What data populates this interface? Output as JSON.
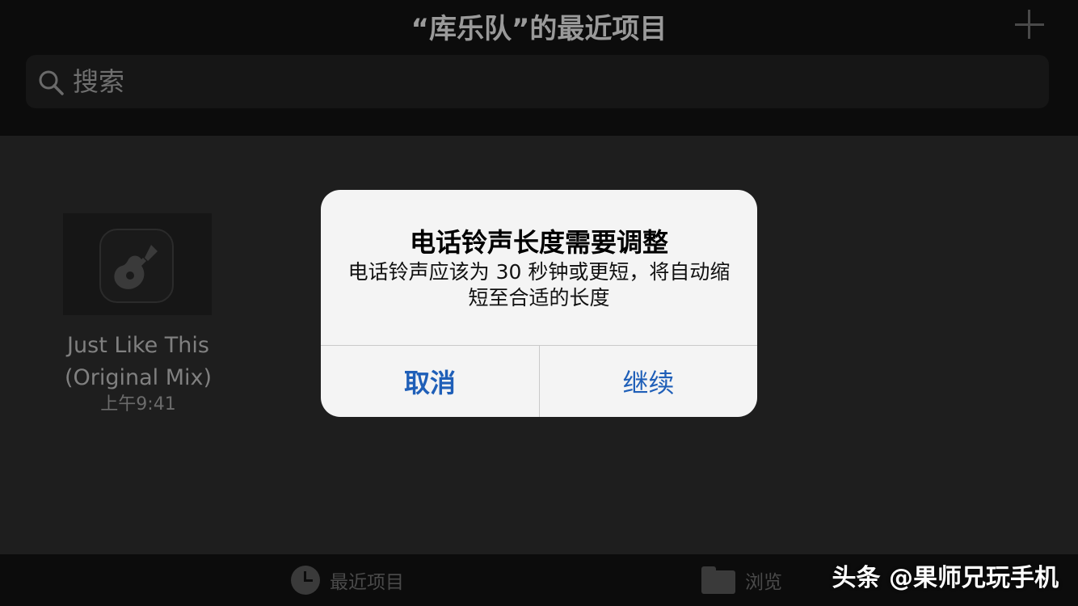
{
  "header": {
    "title": "“库乐队”的最近项目",
    "add_icon": "plus-icon"
  },
  "search": {
    "placeholder": "搜索",
    "icon": "search-icon"
  },
  "project": {
    "title": "Just Like This (Original Mix)",
    "time": "上午9:41",
    "icon": "garageband-guitar-icon"
  },
  "tabbar": {
    "recent_label": "最近项目",
    "browse_label": "浏览",
    "recent_icon": "clock-icon",
    "browse_icon": "folder-icon"
  },
  "alert": {
    "title": "电话铃声长度需要调整",
    "message": "电话铃声应该为 30 秒钟或更短，将自动缩短至合适的长度",
    "cancel_label": "取消",
    "continue_label": "继续",
    "button_color": "#1f5fb8"
  },
  "watermark": {
    "text": "头条 @果师兄玩手机"
  }
}
